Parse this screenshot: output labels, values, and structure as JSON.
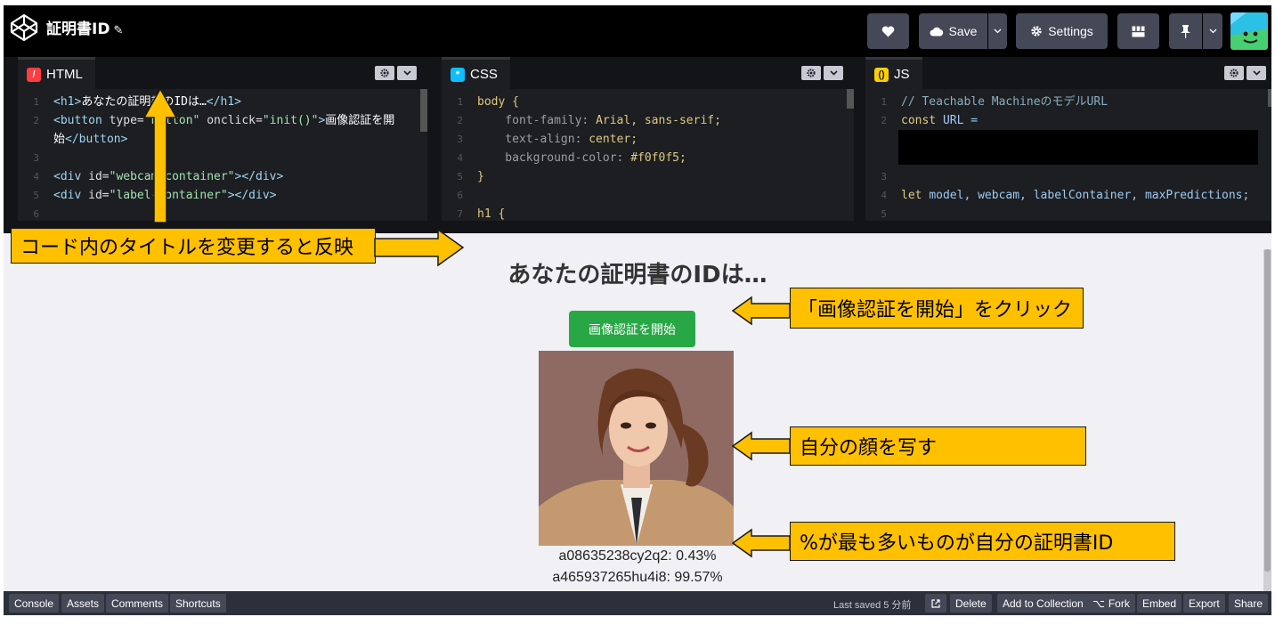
{
  "header": {
    "pen_title": "証明書ID",
    "save_label": "Save",
    "settings_label": "Settings"
  },
  "editors": {
    "html": {
      "tab_label": "HTML",
      "lines": [
        {
          "n": "1",
          "parts": [
            "<h1>",
            "あなたの証明書のIDは…",
            "</h1>"
          ]
        },
        {
          "n": "2",
          "parts": [
            "<button ",
            "type=",
            "\"button\"",
            " onclick=",
            "\"init()\"",
            ">",
            "画像認証を開"
          ]
        },
        {
          "n": "",
          "parts": [
            "始",
            "</button>"
          ]
        },
        {
          "n": "3",
          "parts": [
            ""
          ]
        },
        {
          "n": "4",
          "parts": [
            "<div ",
            "id=",
            "\"webcam-container\"",
            "></div>"
          ]
        },
        {
          "n": "5",
          "parts": [
            "<div ",
            "id=",
            "\"label-container\"",
            "></div>"
          ]
        },
        {
          "n": "6",
          "parts": [
            ""
          ]
        }
      ]
    },
    "css": {
      "tab_label": "CSS",
      "lines": [
        {
          "n": "1",
          "parts": [
            "body {"
          ]
        },
        {
          "n": "2",
          "parts": [
            "    font-family: ",
            "Arial, sans-serif;"
          ]
        },
        {
          "n": "3",
          "parts": [
            "    text-align: ",
            "center;"
          ]
        },
        {
          "n": "4",
          "parts": [
            "    background-color: ",
            "#f0f0f5;"
          ]
        },
        {
          "n": "5",
          "parts": [
            "}"
          ]
        },
        {
          "n": "6",
          "parts": [
            ""
          ]
        },
        {
          "n": "7",
          "parts": [
            "h1 {"
          ]
        }
      ]
    },
    "js": {
      "tab_label": "JS",
      "lines": [
        {
          "n": "1",
          "parts": [
            "// Teachable Machineのモデル",
            "URL"
          ]
        },
        {
          "n": "2",
          "parts": [
            "const ",
            "URL =",
            ""
          ]
        },
        {
          "n": "",
          "parts": [
            ""
          ]
        },
        {
          "n": "",
          "parts": [
            ""
          ]
        },
        {
          "n": "3",
          "parts": [
            ""
          ]
        },
        {
          "n": "4",
          "parts": [
            "let ",
            "model, webcam, labelContainer, maxPredictions;"
          ]
        },
        {
          "n": "5",
          "parts": [
            ""
          ]
        }
      ]
    }
  },
  "preview": {
    "heading": "あなたの証明書のIDは…",
    "button_label": "画像認証を開始",
    "labels": [
      "a08635238cy2q2: 0.43%",
      "a465937265hu4i8: 99.57%"
    ]
  },
  "annotations": {
    "title_note": "コード内のタイトルを変更すると反映",
    "click_note": "「画像認証を開始」をクリック",
    "face_note": "自分の顔を写す",
    "id_note": "%が最も多いものが自分の証明書ID"
  },
  "footer": {
    "left": [
      "Console",
      "Assets",
      "Comments",
      "Shortcuts"
    ],
    "last_saved": "Last saved 5 分前",
    "right": [
      "Delete",
      "Add to Collection",
      "Fork",
      "Embed",
      "Export",
      "Share"
    ]
  },
  "colors": {
    "accent_green": "#28a745",
    "note_yellow": "#ffc000",
    "preview_bg": "#f0f0f5"
  }
}
